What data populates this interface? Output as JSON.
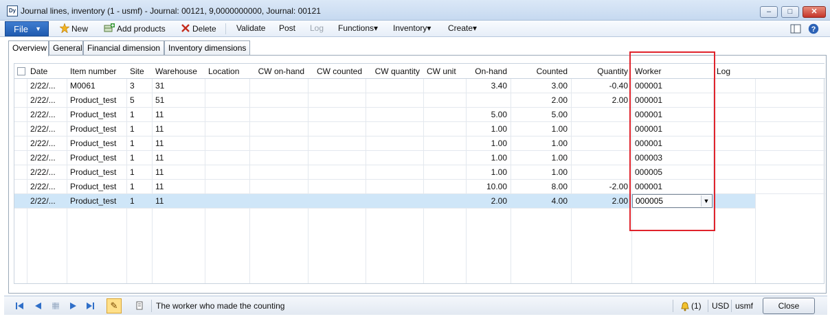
{
  "window": {
    "title": "Journal lines, inventory (1 - usmf) - Journal: 00121, 9,0000000000, Journal: 00121",
    "app_icon_text": "Dy",
    "controls": {
      "minimize": "–",
      "maximize": "□",
      "close": "✕"
    }
  },
  "toolbar": {
    "file_label": "File",
    "new_label": "New",
    "add_products_label": "Add products",
    "delete_label": "Delete",
    "validate_label": "Validate",
    "post_label": "Post",
    "log_label": "Log",
    "functions_label": "Functions▾",
    "inventory_label": "Inventory▾",
    "create_label": "Create▾"
  },
  "tabs": [
    {
      "label": "Overview"
    },
    {
      "label": "General"
    },
    {
      "label": "Financial dimension"
    },
    {
      "label": "Inventory dimensions"
    }
  ],
  "grid": {
    "columns": [
      "Date",
      "Item number",
      "Site",
      "Warehouse",
      "Location",
      "CW on-hand",
      "CW counted",
      "CW quantity",
      "CW unit",
      "On-hand",
      "Counted",
      "Quantity",
      "Worker",
      "Log"
    ],
    "rows": [
      {
        "date": "2/22/...",
        "item": "M0061",
        "site": "3",
        "warehouse": "31",
        "onhand": "3.40",
        "counted": "3.00",
        "quantity": "-0.40",
        "worker": "000001"
      },
      {
        "date": "2/22/...",
        "item": "Product_test",
        "site": "5",
        "warehouse": "51",
        "onhand": "",
        "counted": "2.00",
        "quantity": "2.00",
        "worker": "000001"
      },
      {
        "date": "2/22/...",
        "item": "Product_test",
        "site": "1",
        "warehouse": "11",
        "onhand": "5.00",
        "counted": "5.00",
        "quantity": "",
        "worker": "000001"
      },
      {
        "date": "2/22/...",
        "item": "Product_test",
        "site": "1",
        "warehouse": "11",
        "onhand": "1.00",
        "counted": "1.00",
        "quantity": "",
        "worker": "000001"
      },
      {
        "date": "2/22/...",
        "item": "Product_test",
        "site": "1",
        "warehouse": "11",
        "onhand": "1.00",
        "counted": "1.00",
        "quantity": "",
        "worker": "000001"
      },
      {
        "date": "2/22/...",
        "item": "Product_test",
        "site": "1",
        "warehouse": "11",
        "onhand": "1.00",
        "counted": "1.00",
        "quantity": "",
        "worker": "000003"
      },
      {
        "date": "2/22/...",
        "item": "Product_test",
        "site": "1",
        "warehouse": "11",
        "onhand": "1.00",
        "counted": "1.00",
        "quantity": "",
        "worker": "000005"
      },
      {
        "date": "2/22/...",
        "item": "Product_test",
        "site": "1",
        "warehouse": "11",
        "onhand": "10.00",
        "counted": "8.00",
        "quantity": "-2.00",
        "worker": "000001"
      },
      {
        "date": "2/22/...",
        "item": "Product_test",
        "site": "1",
        "warehouse": "11",
        "onhand": "2.00",
        "counted": "4.00",
        "quantity": "2.00",
        "worker": "000005"
      }
    ]
  },
  "statusbar": {
    "help_text": "The worker who made the counting",
    "notifications": "(1)",
    "currency": "USD",
    "company": "usmf",
    "close_label": "Close"
  },
  "colors": {
    "accent": "#1f5bb0",
    "selected_row": "#cfe6f8",
    "highlight_box": "#e0232b"
  }
}
